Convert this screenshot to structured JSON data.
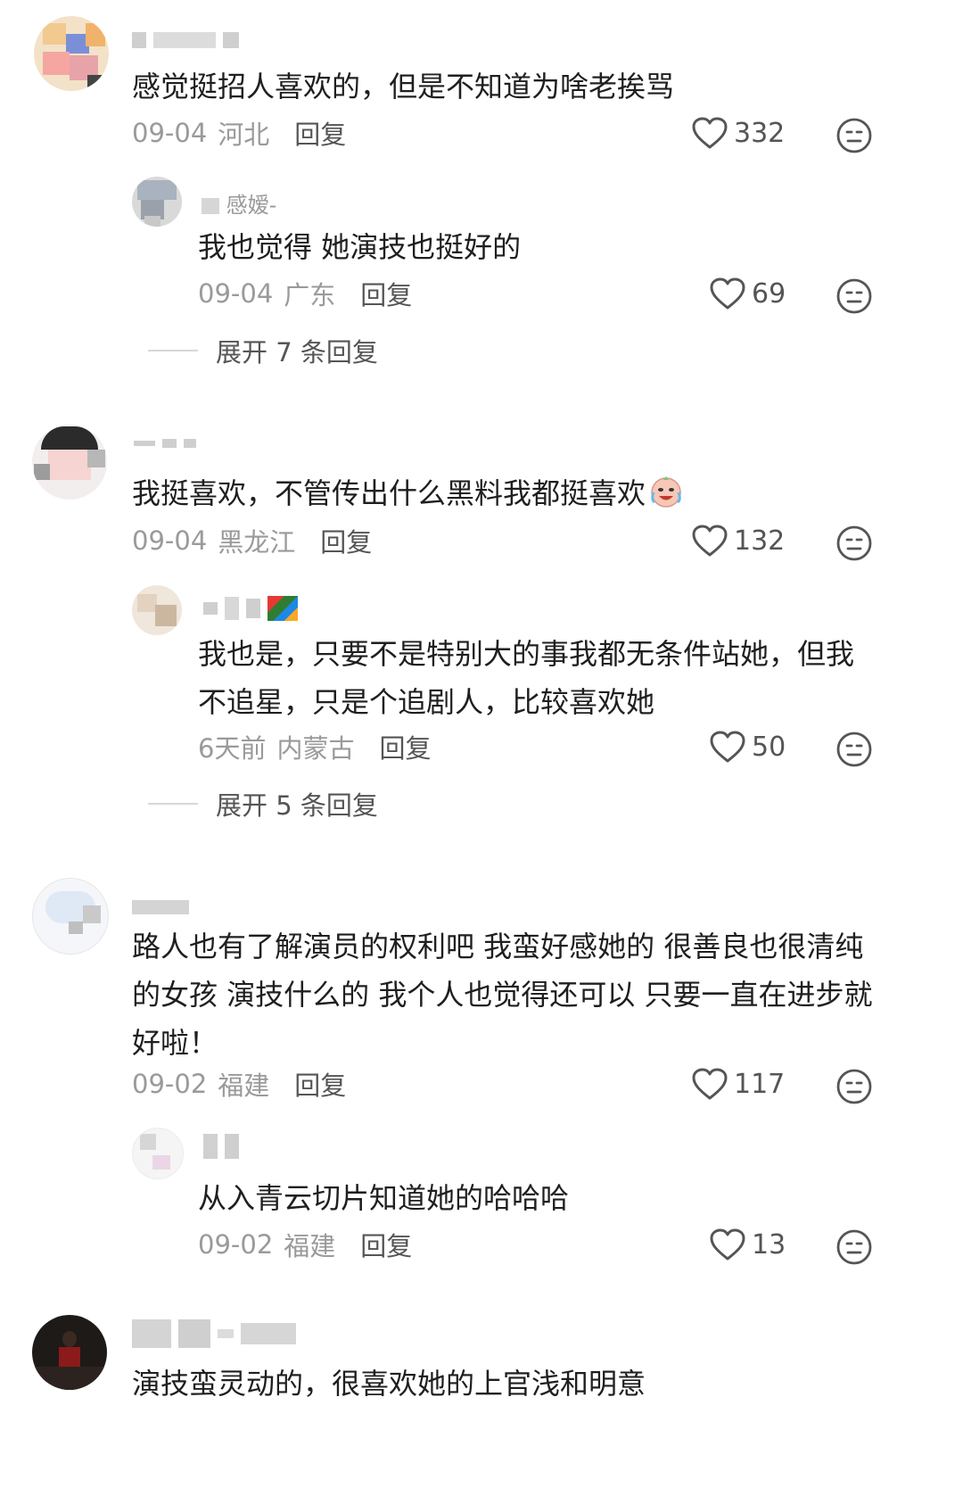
{
  "comments": [
    {
      "text": "感觉挺招人喜欢的，但是不知道为啥老挨骂",
      "date": "09-04",
      "location": "河北",
      "reply_label": "回复",
      "likes": "332",
      "replies": [
        {
          "name": "感嫒-",
          "text": "我也觉得 她演技也挺好的",
          "date": "09-04",
          "location": "广东",
          "reply_label": "回复",
          "likes": "69"
        }
      ],
      "expand_label": "展开 7 条回复"
    },
    {
      "text": "我挺喜欢，不管传出什么黑料我都挺喜欢",
      "date": "09-04",
      "location": "黑龙江",
      "reply_label": "回复",
      "likes": "132",
      "replies": [
        {
          "text_line1": "我也是，只要不是特别大的事我都无条件站她，但我",
          "text_line2": "不追星，只是个追剧人，比较喜欢她",
          "date": "6天前",
          "location": "内蒙古",
          "reply_label": "回复",
          "likes": "50"
        }
      ],
      "expand_label": "展开 5 条回复"
    },
    {
      "text_line1": "路人也有了解演员的权利吧 我蛮好感她的 很善良也很清纯",
      "text_line2": "的女孩 演技什么的 我个人也觉得还可以 只要一直在进步就",
      "text_line3": "好啦！",
      "date": "09-02",
      "location": "福建",
      "reply_label": "回复",
      "likes": "117",
      "replies": [
        {
          "text": "从入青云切片知道她的哈哈哈",
          "date": "09-02",
          "location": "福建",
          "reply_label": "回复",
          "likes": "13"
        }
      ]
    },
    {
      "text": "演技蛮灵动的，很喜欢她的上官浅和明意"
    }
  ],
  "icons": {
    "like": "heart-outline-icon",
    "dislike": "neutral-face-icon",
    "emoji": "crying-laughing-emoji-icon"
  },
  "colors": {
    "meta_gray": "#9a9a9a",
    "text": "#1f1f1f",
    "reply_btn": "#555555"
  }
}
